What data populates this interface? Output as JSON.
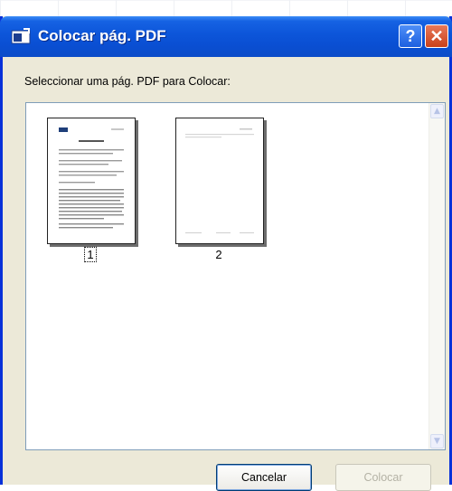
{
  "window": {
    "title": "Colocar pág. PDF",
    "help_label": "?",
    "close_label": "✕"
  },
  "prompt": "Seleccionar uma pág. PDF para Colocar:",
  "pages": [
    {
      "label": "1"
    },
    {
      "label": "2"
    }
  ],
  "buttons": {
    "cancel": "Cancelar",
    "place": "Colocar"
  }
}
